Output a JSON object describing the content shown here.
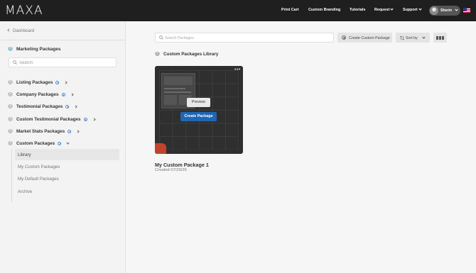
{
  "app": {
    "logo": "MAXA"
  },
  "topnav": {
    "items": [
      "Print Cart",
      "Custom Branding",
      "Tutorials",
      "Request",
      "Support"
    ],
    "user_name": "Sherin"
  },
  "sidebar": {
    "back_label": "Dashboard",
    "section_title": "Marketing Packages",
    "search_placeholder": "Search",
    "categories": [
      "Listing Packages",
      "Company Packages",
      "Testimonial Packages",
      "Custom Testimonial Packages",
      "Market Stats Packages",
      "Custom Packages"
    ],
    "sub_items": [
      "Library",
      "My Custom Packages",
      "My Default Packages",
      "Archive"
    ]
  },
  "toolbar": {
    "search_placeholder": "Search Packages",
    "create_label": "Create Custom Package",
    "sort_label": "Sort by"
  },
  "main": {
    "library_title": "Custom Packages Library",
    "card": {
      "menu": "•••",
      "preview_label": "Preview",
      "create_label": "Create Package",
      "title": "My Custom Package 1",
      "created": "Created 07/29/26"
    }
  },
  "colors": {
    "topbar": "#1f1f1f",
    "accent": "#1f66b7",
    "card_bg": "#2f2f2f",
    "badge": "#d9472b"
  }
}
